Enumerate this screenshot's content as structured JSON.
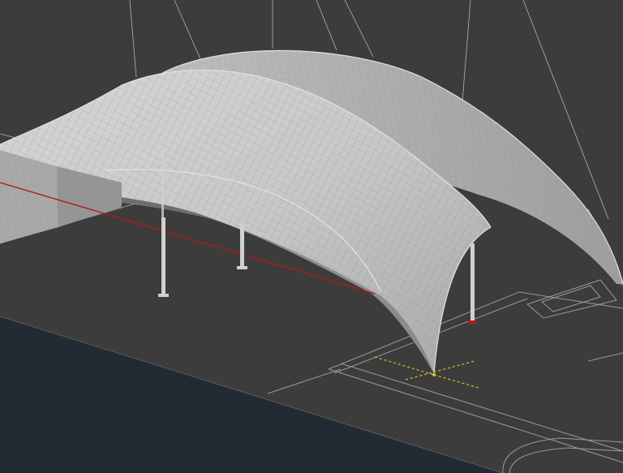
{
  "viewport": {
    "kind": "3d-cad-viewport",
    "background_color": "#3c3c3c",
    "water_color": "#222a33",
    "canopy_color": "#c9c9c9",
    "canopy_grid_color": "#8a8a8a",
    "guide_line_color": "#b4b4b4",
    "axis_line_color": "#b01a1a",
    "snap_marker_color": "#d9c21a",
    "column_count": 4,
    "visual_style": "wireframe-shaded"
  }
}
